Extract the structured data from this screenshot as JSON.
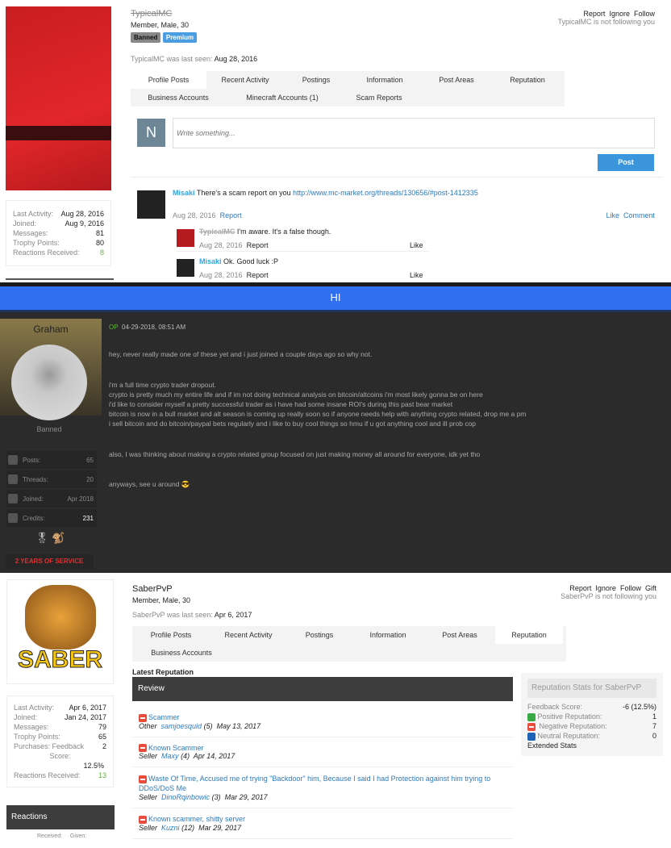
{
  "profile1": {
    "username": "TypicalMC",
    "subtitle": "Member, Male, 30",
    "badges": [
      "Banned",
      "Premium"
    ],
    "actions": [
      "Report",
      "Ignore",
      "Follow"
    ],
    "follow_status": "TypicalMC is not following you",
    "last_seen_label": "TypicalMC was last seen:",
    "last_seen": "Aug 28, 2016",
    "tabs": [
      "Profile Posts",
      "Recent Activity",
      "Postings",
      "Information",
      "Post Areas",
      "Reputation",
      "Business Accounts",
      "Minecraft Accounts (1)",
      "Scam Reports"
    ],
    "active_tab": "Profile Posts",
    "stats": [
      [
        "Last Activity:",
        "Aug 28, 2016"
      ],
      [
        "Joined:",
        "Aug 9, 2016"
      ],
      [
        "Messages:",
        "81"
      ],
      [
        "Trophy Points:",
        "80"
      ],
      [
        "Reactions Received:",
        "8"
      ]
    ],
    "composer": {
      "avatar_letter": "N",
      "placeholder": "Write something...",
      "post_label": "Post"
    },
    "post": {
      "author": "Misaki",
      "text": "There's a scam report on you",
      "link": "http://www.mc-market.org/threads/130656/#post-1412335",
      "date": "Aug 28, 2016",
      "report": "Report",
      "like": "Like",
      "comment": "Comment",
      "comments": [
        {
          "author": "TypicalMC",
          "text": "I'm aware. It's a false though.",
          "date": "Aug 28, 2016",
          "report": "Report",
          "like": "Like"
        },
        {
          "author": "Misaki",
          "text": "Ok. Good luck :P",
          "date": "Aug 28, 2016",
          "report": "Report",
          "like": "Like"
        }
      ]
    }
  },
  "thread": {
    "title": "HI",
    "accent": "#2f6ff0",
    "username": "Graham",
    "rank": "Banned",
    "op": "OP",
    "timestamp": "04-29-2018, 08:51 AM",
    "stats": [
      [
        "Posts:",
        "65"
      ],
      [
        "Threads:",
        "20"
      ],
      [
        "Joined:",
        "Apr 2018"
      ],
      [
        "Credits:",
        "231"
      ]
    ],
    "service": "2 YEARS OF SERVICE",
    "paragraphs": [
      "hey, never really made one of these yet and i just joined a couple days ago so why not.",
      "i'm a full time crypto trader dropout.\ncrypto is pretty much my entire life and if im not doing technical analysis on bitcoin/altcoins i'm most likely gonna be on here\ni'd like to consider myself a pretty successful trader as i have had some insane ROI's during this past bear market\nbitcoin is now in a bull market and alt season is coming up really soon so if anyone needs help with anything crypto related, drop me a pm\ni sell bitcoin and do bitcoin/paypal bets regularly and i like to buy cool things so hmu if u got anything cool and ill prob cop",
      "also, I was thinking about making a crypto related group focused on just making money all around for everyone, idk yet tho",
      "anyways, see u around"
    ]
  },
  "profile2": {
    "username": "SaberPvP",
    "subtitle": "Member, Male, 30",
    "actions": [
      "Report",
      "Ignore",
      "Follow",
      "Gift"
    ],
    "follow_status": "SaberPvP is not following you",
    "last_seen_label": "SaberPvP was last seen:",
    "last_seen": "Apr 6, 2017",
    "tabs": [
      "Profile Posts",
      "Recent Activity",
      "Postings",
      "Information",
      "Post Areas",
      "Reputation",
      "Business Accounts"
    ],
    "active_tab": "Reputation",
    "avatar_text": "SABER",
    "stats": [
      [
        "Last Activity:",
        "Apr 6, 2017"
      ],
      [
        "Joined:",
        "Jan 24, 2017"
      ],
      [
        "Messages:",
        "79"
      ],
      [
        "Trophy Points:",
        "65"
      ],
      [
        "Purchases: Feedback",
        "2"
      ],
      [
        "Score:",
        ""
      ],
      [
        "",
        "12.5%"
      ],
      [
        "Reactions Received:",
        "13"
      ]
    ],
    "reactions": {
      "title": "Reactions",
      "received": "Received:",
      "given": "Given:"
    },
    "latest_label": "Latest Reputation",
    "review_label": "Review",
    "reviews": [
      {
        "title": "Scammer",
        "role": "Other",
        "user": "samjoesquid",
        "count": "(5)",
        "date": "May 13, 2017"
      },
      {
        "title": "Known Scammer",
        "role": "Seller",
        "user": "Maxy",
        "count": "(4)",
        "date": "Apr 14, 2017"
      },
      {
        "title": "Waste Of Time, Accused me of trying \"Backdoor\" him, Because I said I had Protection against him trying to DDoS/DoS Me",
        "role": "Seller",
        "user": "DinoRqinbowic",
        "count": "(3)",
        "date": "Mar 29, 2017"
      },
      {
        "title": "Known scammer, shitty server",
        "role": "Seller",
        "user": "Kuzni",
        "count": "(12)",
        "date": "Mar 29, 2017"
      }
    ],
    "rep_stats": {
      "title": "Reputation Stats for SaberPvP",
      "rows": [
        [
          "Feedback Score:",
          "-6 (12.5%)"
        ],
        [
          "Positive Reputation:",
          "1"
        ],
        [
          "Negative Reputation:",
          "7"
        ],
        [
          "Neutral Reputation:",
          "0"
        ]
      ],
      "extended": "Extended Stats"
    }
  }
}
